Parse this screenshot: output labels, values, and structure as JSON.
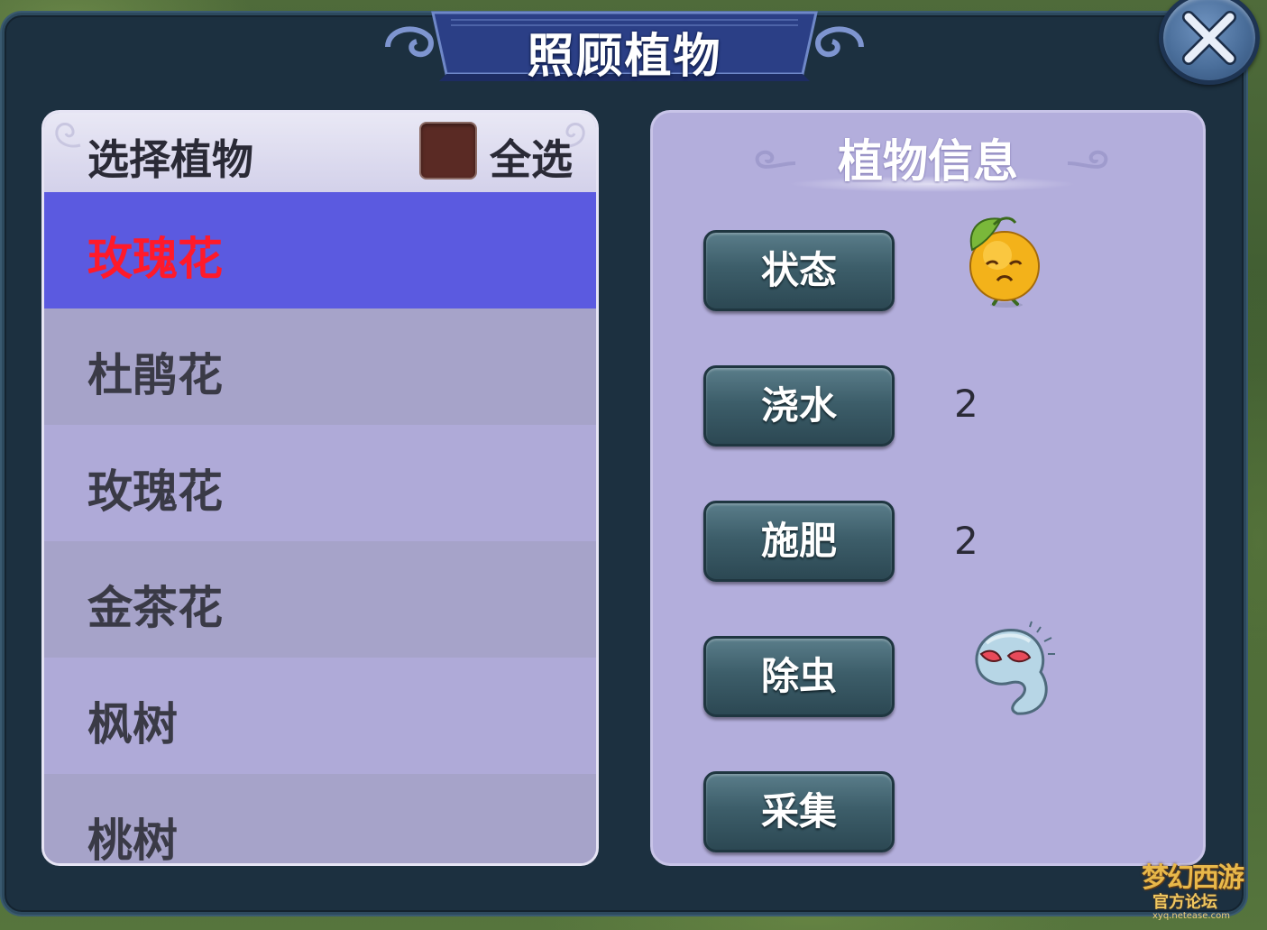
{
  "window": {
    "title": "照顾植物",
    "close_icon": "close-x-icon"
  },
  "left_panel": {
    "header_label": "选择植物",
    "select_all_label": "全选",
    "select_all_checked": false,
    "plants": [
      {
        "name": "玫瑰花",
        "selected": true
      },
      {
        "name": "杜鹃花",
        "selected": false
      },
      {
        "name": "玫瑰花",
        "selected": false
      },
      {
        "name": "金茶花",
        "selected": false
      },
      {
        "name": "枫树",
        "selected": false
      },
      {
        "name": "桃树",
        "selected": false
      }
    ]
  },
  "right_panel": {
    "title": "植物信息",
    "actions": [
      {
        "label": "状态",
        "value_type": "icon",
        "icon": "sad-fruit-status-icon"
      },
      {
        "label": "浇水",
        "value": "2"
      },
      {
        "label": "施肥",
        "value": "2"
      },
      {
        "label": "除虫",
        "value_type": "icon",
        "icon": "worm-pest-icon"
      },
      {
        "label": "采集"
      }
    ]
  },
  "watermark": {
    "logo_text": "梦幻西游",
    "sub_text": "官方论坛",
    "url": "xyq.netease.com"
  },
  "colors": {
    "selected_row": "#5b5ae0",
    "selected_text": "#ff1a2a",
    "panel_bg": "#b3aedc",
    "frame_bg": "#1c3040",
    "button_bg": "#3d5e6a"
  }
}
